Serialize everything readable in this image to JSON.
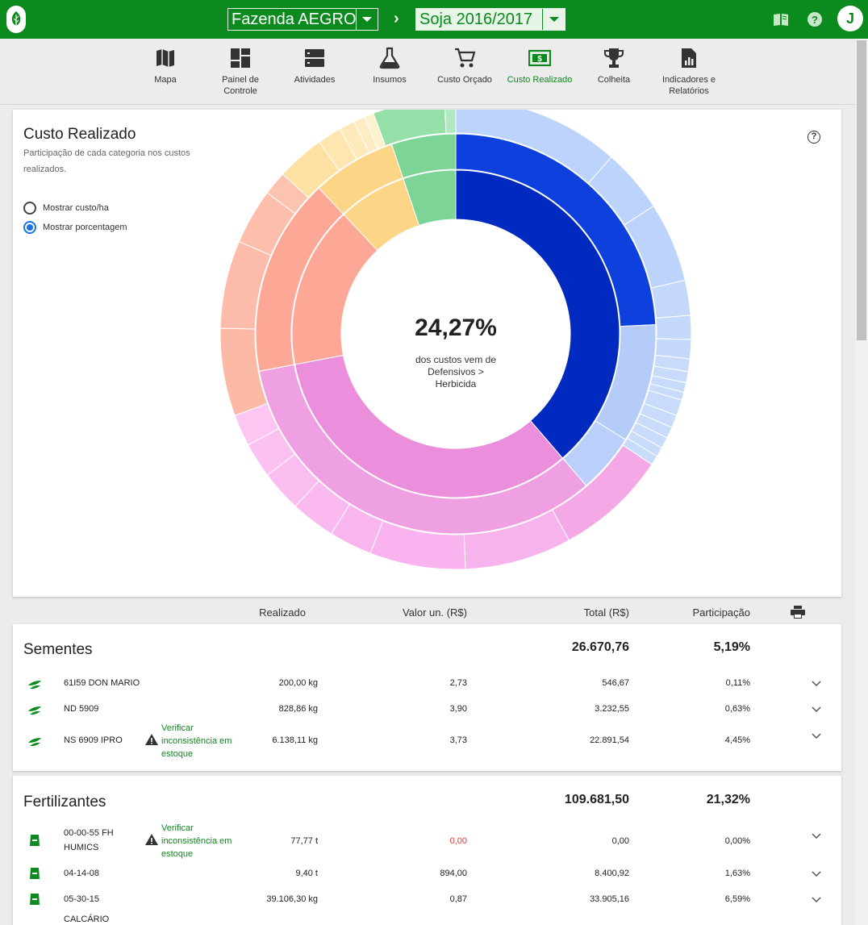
{
  "topbar": {
    "farm": "Fazenda AEGRO",
    "season": "Soja 2016/2017",
    "separator": "›",
    "avatar": "J",
    "icons": [
      "leaf-logo-icon",
      "book-icon",
      "help-icon"
    ]
  },
  "nav": {
    "items": [
      {
        "label": "Mapa",
        "icon": "map-icon"
      },
      {
        "label": "Painel de Controle",
        "icon": "dashboard-icon"
      },
      {
        "label": "Atividades",
        "icon": "activities-icon"
      },
      {
        "label": "Insumos",
        "icon": "flask-icon"
      },
      {
        "label": "Custo Orçado",
        "icon": "cart-icon"
      },
      {
        "label": "Custo Realizado",
        "icon": "dollar-icon",
        "active": true
      },
      {
        "label": "Colheita",
        "icon": "trophy-icon"
      },
      {
        "label": "Indicadores e Relatórios",
        "icon": "report-icon"
      }
    ]
  },
  "chart_card": {
    "title": "Custo Realizado",
    "subtitle": "Participação de cada categoria nos custos realizados.",
    "radio_cost": "Mostrar custo/ha",
    "radio_pct": "Mostrar porcentagem",
    "selected_option": "Mostrar porcentagem",
    "help": "?"
  },
  "chart_data": {
    "type": "sunburst",
    "center_value": "24,27%",
    "center_label": "dos custos vem de Defensivos > Herbicida",
    "inner": [
      {
        "value": 38.7,
        "color": "#0029bf"
      },
      {
        "value": 33.3,
        "color": "#eb8fdc"
      },
      {
        "value": 16.0,
        "color": "#fda897"
      },
      {
        "value": 6.8,
        "color": "#fdd587"
      },
      {
        "value": 5.19,
        "color": "#7cd497"
      }
    ],
    "middle": [
      {
        "value": 24.27,
        "color": "#0d40dd"
      },
      {
        "value": 9.6,
        "color": "#b4ccf7"
      },
      {
        "value": 4.83,
        "color": "#bad0fa"
      },
      {
        "value": 33.3,
        "color": "#efa0e3"
      },
      {
        "value": 16.0,
        "color": "#fda897"
      },
      {
        "value": 6.8,
        "color": "#fdd587"
      },
      {
        "value": 5.19,
        "color": "#7cd497"
      }
    ],
    "outer": [
      {
        "value": 10.5,
        "color": "#bcd3fb"
      },
      {
        "value": 4.0,
        "color": "#bcd3fb"
      },
      {
        "value": 5.0,
        "color": "#bcd3fb"
      },
      {
        "value": 2.2,
        "color": "#c4d8fb"
      },
      {
        "value": 1.5,
        "color": "#c4d8fb"
      },
      {
        "value": 1.2,
        "color": "#c4d8fb"
      },
      {
        "value": 0.8,
        "color": "#c8dbfb"
      },
      {
        "value": 0.7,
        "color": "#c8dbfb"
      },
      {
        "value": 0.6,
        "color": "#c8dbfb"
      },
      {
        "value": 0.5,
        "color": "#c8dbfb"
      },
      {
        "value": 1.0,
        "color": "#c8dbfb"
      },
      {
        "value": 0.8,
        "color": "#c8dbfb"
      },
      {
        "value": 0.7,
        "color": "#c8dbfb"
      },
      {
        "value": 0.7,
        "color": "#c8dbfb"
      },
      {
        "value": 0.6,
        "color": "#c8dbfb"
      },
      {
        "value": 0.6,
        "color": "#c8dbfb"
      },
      {
        "value": 7.0,
        "color": "#f4a9e6"
      },
      {
        "value": 6.7,
        "color": "#f7b3ec"
      },
      {
        "value": 6.0,
        "color": "#f9b3ee"
      },
      {
        "value": 2.7,
        "color": "#f9b6ee"
      },
      {
        "value": 2.8,
        "color": "#fab9ef"
      },
      {
        "value": 2.6,
        "color": "#fbbdf0"
      },
      {
        "value": 2.2,
        "color": "#fbc1f1"
      },
      {
        "value": 2.0,
        "color": "#fcc5f2"
      },
      {
        "value": 5.5,
        "color": "#fcb9a5"
      },
      {
        "value": 5.5,
        "color": "#fdbca9"
      },
      {
        "value": 3.5,
        "color": "#fdbfac"
      },
      {
        "value": 1.5,
        "color": "#fdc3b1"
      },
      {
        "value": 3.0,
        "color": "#fee2a3"
      },
      {
        "value": 1.5,
        "color": "#fee6b0"
      },
      {
        "value": 1.0,
        "color": "#fee9ba"
      },
      {
        "value": 0.7,
        "color": "#feedc4"
      },
      {
        "value": 0.6,
        "color": "#fef1ce"
      },
      {
        "value": 4.5,
        "color": "#94e0a8"
      },
      {
        "value": 0.7,
        "color": "#b0e8c0"
      }
    ]
  },
  "table": {
    "headers": {
      "realizado": "Realizado",
      "valor_un": "Valor un. (R$)",
      "total": "Total (R$)",
      "participacao": "Participação"
    },
    "warning_text": "Verificar inconsistência em estoque",
    "categories": [
      {
        "name": "Sementes",
        "total": "26.670,76",
        "share": "5,19%",
        "rows": [
          {
            "name": "61I59 DON MARIO",
            "realizado": "200,00 kg",
            "valor_un": "2,73",
            "total": "546,67",
            "share": "0,11%",
            "warning": false
          },
          {
            "name": "ND 5909",
            "realizado": "828,86 kg",
            "valor_un": "3,90",
            "total": "3.232,55",
            "share": "0,63%",
            "warning": false
          },
          {
            "name": "NS 6909 IPRO",
            "realizado": "6.138,11 kg",
            "valor_un": "3,73",
            "total": "22.891,54",
            "share": "4,45%",
            "warning": true
          }
        ]
      },
      {
        "name": "Fertilizantes",
        "total": "109.681,50",
        "share": "21,32%",
        "rows": [
          {
            "name": "00-00-55 FH HUMICS",
            "realizado": "77,77 t",
            "valor_un": "0,00",
            "total": "0,00",
            "share": "0,00%",
            "warning": true,
            "red": true
          },
          {
            "name": "04-14-08",
            "realizado": "9,40 t",
            "valor_un": "894,00",
            "total": "8.400,92",
            "share": "1,63%",
            "warning": false
          },
          {
            "name": "05-30-15",
            "realizado": "39.106,30 kg",
            "valor_un": "0,87",
            "total": "33.905,16",
            "share": "6,59%",
            "warning": false
          },
          {
            "name": "CALCÁRIO",
            "realizado": "",
            "valor_un": "",
            "total": "",
            "share": "",
            "warning": false
          }
        ]
      }
    ]
  }
}
